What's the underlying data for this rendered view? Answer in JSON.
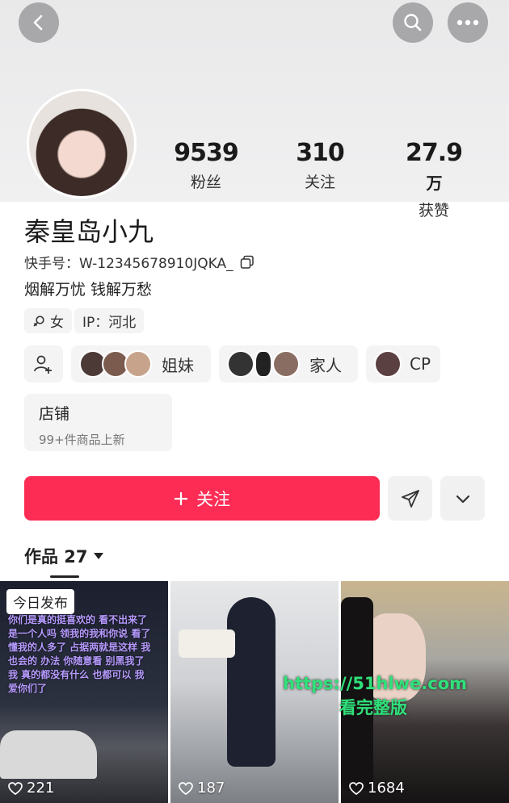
{
  "header": {
    "back_icon": "chevron-left-icon",
    "search_icon": "search-icon",
    "more_icon": "more-dots-icon"
  },
  "stats": [
    {
      "value": "9539",
      "unit": "",
      "label": "粉丝"
    },
    {
      "value": "310",
      "unit": "",
      "label": "关注"
    },
    {
      "value": "27.9",
      "unit": "万",
      "label": "获赞"
    }
  ],
  "profile": {
    "name": "秦皇岛小九",
    "kuaishou_id": "快手号：W-12345678910JQKA_",
    "bio": "烟解万忧 钱解万愁",
    "gender": "女",
    "ip": "IP：河北"
  },
  "groups": [
    {
      "label": "姐妹"
    },
    {
      "label": "家人"
    },
    {
      "label": "CP"
    }
  ],
  "shop": {
    "title": "店铺",
    "subtitle": "99+件商品上新"
  },
  "follow_button": {
    "label": "关注"
  },
  "works_tab": {
    "label": "作品 27"
  },
  "videos": [
    {
      "badge": "今日发布",
      "likes": "221",
      "caption": "你们是真的挺喜欢的 看不出来了 是一个人吗 领我的我和你说 看了 懂我的人多了 占据两就是这样 我 也会的 办法 你随意看 别黑我了 我 真的都没有什么 也都可以 我爱你们了"
    },
    {
      "likes": "187"
    },
    {
      "likes": "1684"
    }
  ],
  "watermark": {
    "line1": "https://51hlwe.com",
    "line2": "看完整版"
  },
  "colors": {
    "accent": "#fd2c55",
    "watermark": "#2fe17a"
  }
}
